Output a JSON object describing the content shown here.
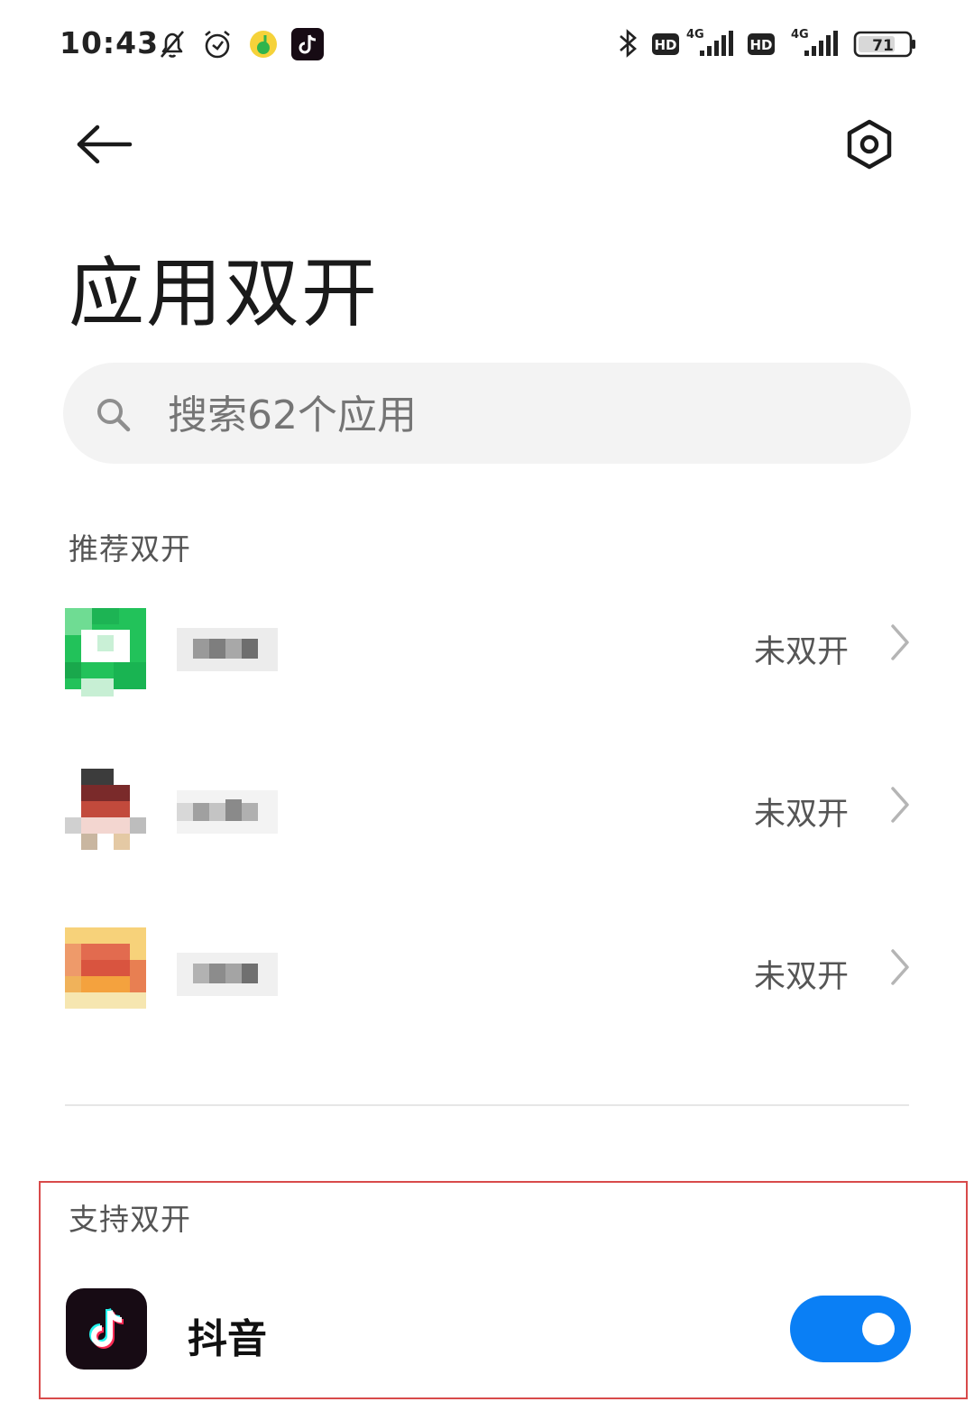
{
  "status_bar": {
    "time": "10:43",
    "battery": "71",
    "network_1": "4G",
    "network_2": "4G",
    "hd_1": "HD",
    "hd_2": "HD",
    "icons": [
      "mute-bell-icon",
      "alarm-icon",
      "music-app-icon",
      "douyin-notification-icon",
      "bluetooth-icon",
      "signal-icon",
      "battery-icon"
    ]
  },
  "header": {
    "back_icon": "back-arrow-icon",
    "settings_icon": "settings-hex-icon"
  },
  "title": "应用双开",
  "search": {
    "placeholder": "搜索62个应用",
    "icon": "search-icon"
  },
  "recommended": {
    "label": "推荐双开",
    "items": [
      {
        "status": "未双开",
        "icon_color": "#1fc45a"
      },
      {
        "status": "未双开",
        "icon_color": "#8a3a3a"
      },
      {
        "status": "未双开",
        "icon_color": "#e9894a"
      }
    ]
  },
  "supported": {
    "label": "支持双开",
    "items": [
      {
        "name": "抖音",
        "enabled": true
      }
    ]
  },
  "colors": {
    "accent": "#0a7ff5",
    "highlight_border": "#d84a4a"
  }
}
